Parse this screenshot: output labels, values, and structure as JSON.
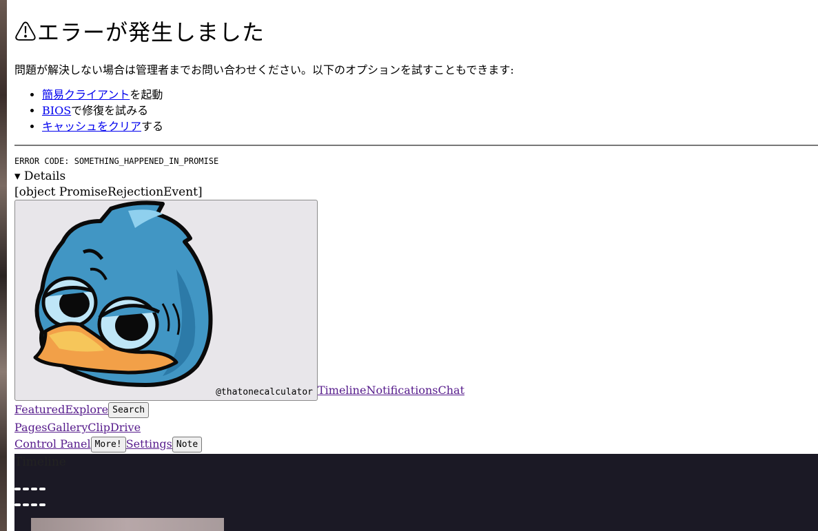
{
  "error": {
    "title": "⚠エラーが発生しました",
    "message": "問題が解決しない場合は管理者までお問い合わせください。以下のオプションを試すこともできます:",
    "options": [
      {
        "link": "簡易クライアント",
        "rest": "を起動"
      },
      {
        "link": "BIOS",
        "rest": "で修復を試みる"
      },
      {
        "link": "キャッシュをクリア",
        "rest": "する"
      }
    ],
    "code": "ERROR CODE: SOMETHING_HAPPENED_IN_PROMISE",
    "details_label": "▾ Details",
    "details_value": "[object PromiseRejectionEvent]"
  },
  "avatar": {
    "credit": "@thatonecalculator",
    "icon": "bird-mascot-icon"
  },
  "nav": {
    "row1": [
      "Timeline",
      "Notifications",
      "Chat"
    ],
    "row2_links": [
      "Featured",
      "Explore"
    ],
    "search_button": "Search",
    "row3": [
      "Pages",
      "Gallery",
      "Clip",
      "Drive"
    ],
    "control_panel": "Control Panel",
    "more_button": "More!",
    "settings": "Settings",
    "note_button": "Note"
  },
  "timeline": {
    "label": "Timeline"
  },
  "colors": {
    "dark_panel": "#1b1925",
    "link": "#0000ee",
    "visited": "#551a8b"
  }
}
